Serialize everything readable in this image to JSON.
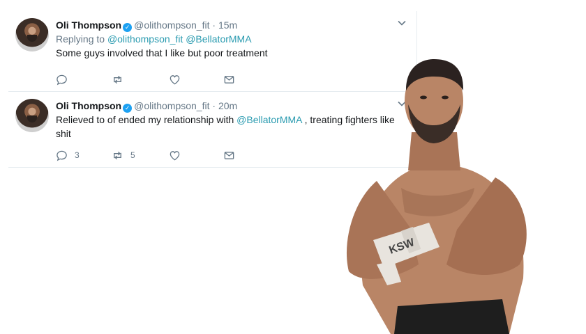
{
  "tweets": [
    {
      "name": "Oli Thompson",
      "handle": "@olithompson_fit",
      "separator": "·",
      "time": "15m",
      "replying_prefix": "Replying to",
      "replying_to": [
        "@olithompson_fit",
        "@BellatorMMA"
      ],
      "text": "Some guys involved that I like but poor treatment",
      "counts": {
        "reply": "",
        "retweet": "",
        "like": ""
      }
    },
    {
      "name": "Oli Thompson",
      "handle": "@olithompson_fit",
      "separator": "·",
      "time": "20m",
      "text_before": "Relieved  to of ended my relationship with",
      "mention": "@BellatorMMA",
      "text_after": ", treating fighters like shit",
      "counts": {
        "reply": "3",
        "retweet": "5",
        "like": ""
      }
    }
  ],
  "icons": {
    "verified": "verified-badge-icon",
    "menu": "chevron-down-icon",
    "reply": "reply-icon",
    "retweet": "retweet-icon",
    "like": "heart-icon",
    "dm": "envelope-icon"
  },
  "colors": {
    "link": "#2a9bb0",
    "secondary_text": "#657786",
    "divider": "#e6ecf0",
    "verified": "#1da1f2"
  },
  "glove_brand": "KSW"
}
